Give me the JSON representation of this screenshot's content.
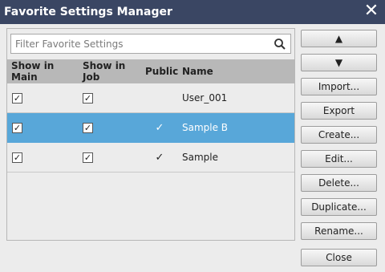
{
  "window": {
    "title": "Favorite Settings Manager",
    "close_glyph": "✕"
  },
  "search": {
    "placeholder": "Filter Favorite Settings"
  },
  "table": {
    "headers": [
      "Show in Main",
      "Show in Job",
      "Public",
      "Name"
    ],
    "rows": [
      {
        "show_in_main": true,
        "show_in_job": true,
        "public": false,
        "name": "User_001",
        "selected": false
      },
      {
        "show_in_main": true,
        "show_in_job": true,
        "public": true,
        "name": "Sample B",
        "selected": true
      },
      {
        "show_in_main": true,
        "show_in_job": true,
        "public": true,
        "name": "Sample",
        "selected": false
      }
    ]
  },
  "buttons": {
    "move_up": "▲",
    "move_down": "▼",
    "import": "Import...",
    "export": "Export",
    "create": "Create...",
    "edit": "Edit...",
    "delete": "Delete...",
    "duplicate": "Duplicate...",
    "rename": "Rename...",
    "close": "Close"
  },
  "glyphs": {
    "check": "✓"
  },
  "colors": {
    "titlebar": "#3a4663",
    "selection": "#58a7d9",
    "header_bg": "#b8b8b8"
  }
}
